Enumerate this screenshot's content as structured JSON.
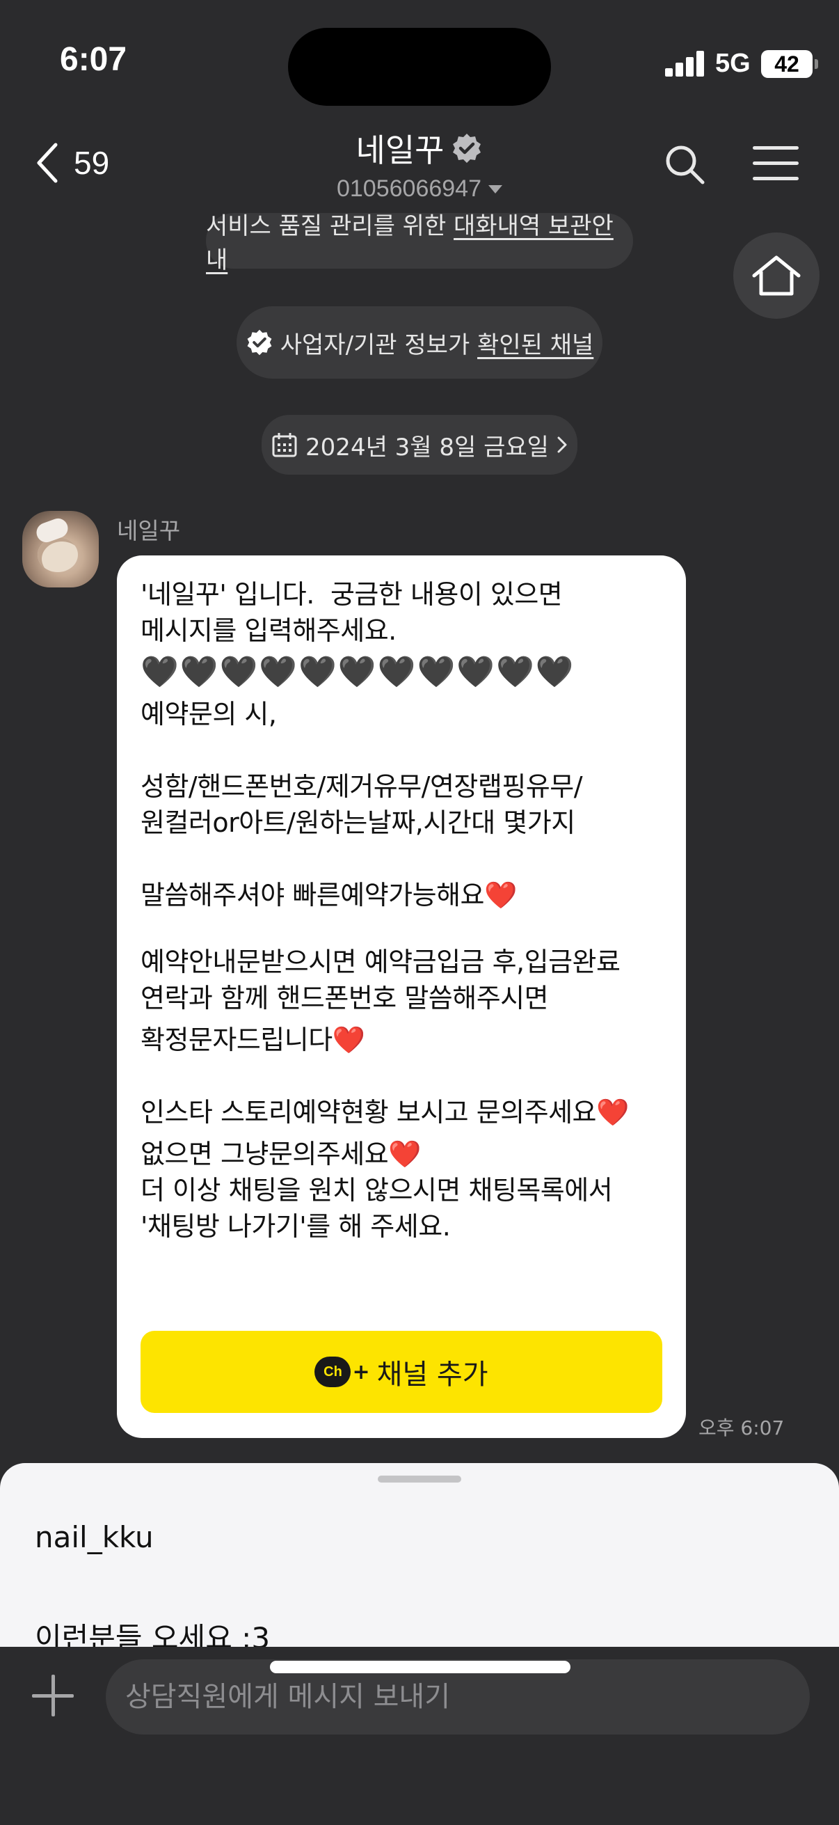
{
  "status_bar": {
    "time": "6:07",
    "network": "5G",
    "battery": "42"
  },
  "header": {
    "back_count": "59",
    "title": "네일꾸",
    "phone": "01056066947",
    "icons": [
      "chevron-left-icon",
      "verified-badge-icon",
      "search-icon",
      "menu-icon",
      "home-icon"
    ]
  },
  "notices": {
    "storage_prefix": "서비스 품질 관리를 위한 ",
    "storage_link": "대화내역 보관안내",
    "verified_prefix": "사업자/기관 정보가 ",
    "verified_link": "확인된 채널",
    "date": "2024년 3월 8일 금요일"
  },
  "message": {
    "sender": "네일꾸",
    "line_intro": "'네일꾸' 입니다.  궁금한 내용이 있으면 메시지를 입력해주세요.",
    "black_hearts": "🖤🖤🖤🖤🖤🖤🖤🖤🖤🖤🖤",
    "line_reserve": "예약문의 시,",
    "line_fields": "성함/핸드폰번호/제거유무/연장랩핑유무/원컬러or아트/원하는날짜,시간대 몇가지",
    "line_fast": "말씀해주셔야 빠른예약가능해요",
    "line_deposit": "예약안내문받으시면 예약금입금 후,입금완료 연락과 함께 핸드폰번호 말씀해주시면",
    "line_confirm": "확정문자드립니다",
    "line_insta": "인스타 스토리예약현황 보시고 문의주세요",
    "line_none": "없으면 그냥문의주세요",
    "line_leave": "더 이상 채팅을 원치 않으시면 채팅목록에서 '채팅방 나가기'를 해 주세요.",
    "red_heart": "❤️",
    "channel_button": "채널 추가",
    "channel_icon_text": "Ch",
    "time": "오후 6:07"
  },
  "sheet": {
    "line1": "nail_kku",
    "line2": "이런분들 오세요 :3"
  },
  "composer": {
    "placeholder": "상담직원에게 메시지 보내기"
  },
  "colors": {
    "background": "#2b2b2d",
    "bubble": "#ffffff",
    "accent_yellow": "#fde400",
    "secondary_text": "#a6a6a8"
  }
}
